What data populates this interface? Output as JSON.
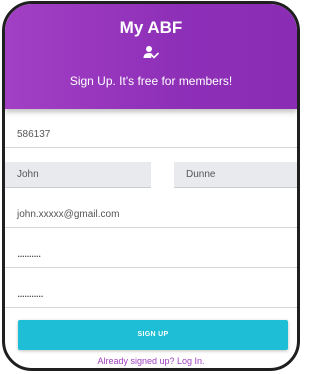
{
  "header": {
    "title": "My ABF",
    "icon": "user-check-icon",
    "subtitle": "Sign Up. It's free for members!"
  },
  "form": {
    "member_id": "586137",
    "first_name": "John",
    "last_name": "Dunne",
    "email": "john.xxxxx@gmail.com",
    "password": "..........",
    "confirm_password": "..........."
  },
  "actions": {
    "signup_label": "SIGN UP",
    "login_link": "Already signed up? Log In."
  },
  "colors": {
    "header": "#9b35c0",
    "button": "#1ebfd6",
    "link": "#a040c0"
  }
}
